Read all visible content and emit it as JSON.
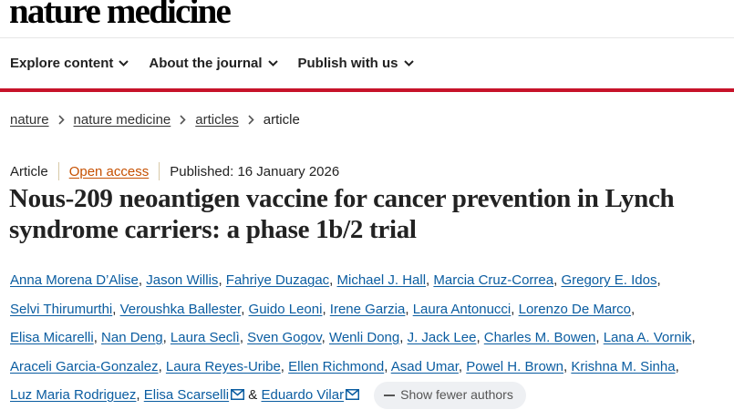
{
  "site": {
    "brand": "nature medicine"
  },
  "nav": [
    {
      "label": "Explore content"
    },
    {
      "label": "About the journal"
    },
    {
      "label": "Publish with us"
    }
  ],
  "breadcrumb": [
    "nature",
    "nature medicine",
    "articles",
    "article"
  ],
  "article": {
    "type": "Article",
    "access": "Open access",
    "published": "Published: 16 January 2026",
    "title": "Nous-209 neoantigen vaccine for cancer prevention in Lynch syndrome carriers: a phase 1b/2 trial"
  },
  "authors": [
    "Anna Morena D’Alise",
    "Jason Willis",
    "Fahriye Duzagac",
    "Michael J. Hall",
    "Marcia Cruz-Correa",
    "Gregory E. Idos",
    "Selvi Thirumurthi",
    "Veroushka Ballester",
    "Guido Leoni",
    "Irene Garzia",
    "Laura Antonucci",
    "Lorenzo De Marco",
    "Elisa Micarelli",
    "Nan Deng",
    "Laura Seclì",
    "Sven Gogov",
    "Wenli Dong",
    "J. Jack Lee",
    "Charles M. Bowen",
    "Lana A. Vornik",
    "Araceli Garcia-Gonzalez",
    "Laura Reyes-Uribe",
    "Ellen Richmond",
    "Asad Umar",
    "Powel H. Brown",
    "Krishna M. Sinha",
    "Luz Maria Rodriguez",
    "Elisa Scarselli",
    "Eduardo Vilar"
  ],
  "authors_conjunction": "&",
  "show_fewer_label": "Show fewer authors",
  "icons": {
    "nav_chevron": "chevron-down-icon",
    "crumb_separator": "chevron-right-icon",
    "email": "mail-icon",
    "collapse": "minus-icon"
  },
  "colors": {
    "accent_red": "#c7132a",
    "author_link": "#0b5da1",
    "open_access": "#c65000"
  }
}
